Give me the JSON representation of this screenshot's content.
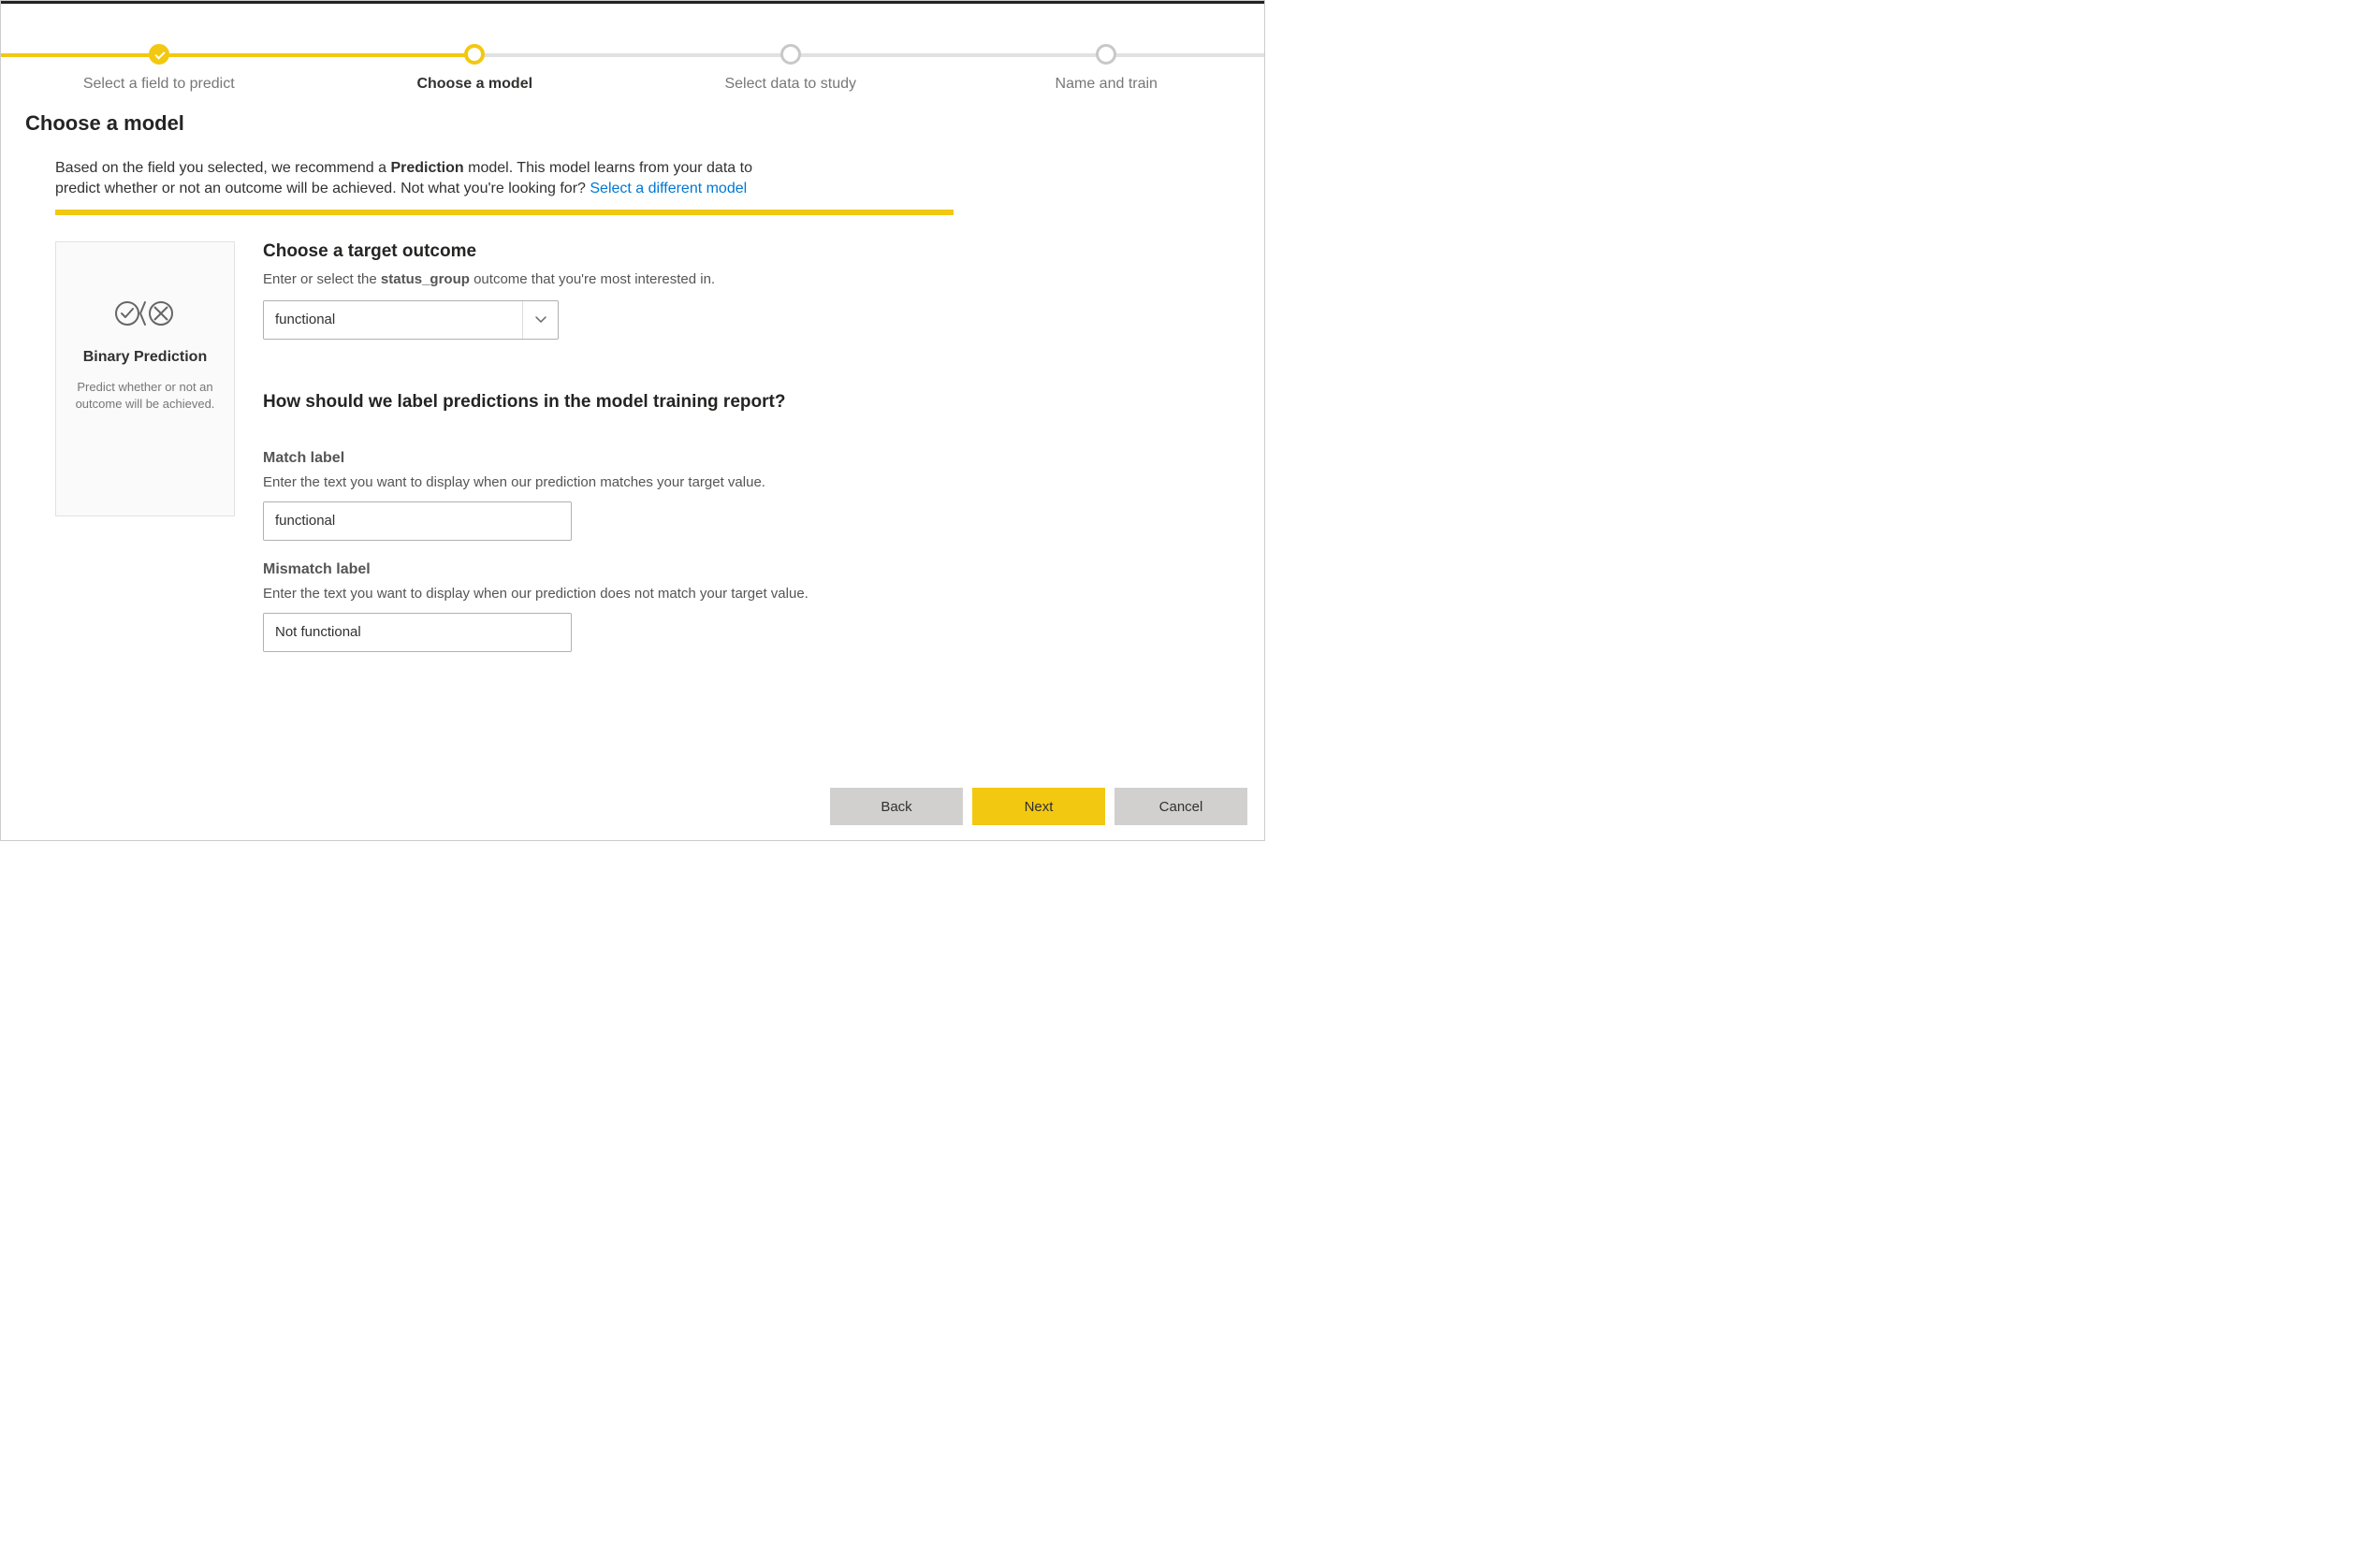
{
  "stepper": {
    "steps": [
      {
        "label": "Select a field to predict",
        "state": "completed"
      },
      {
        "label": "Choose a model",
        "state": "current"
      },
      {
        "label": "Select data to study",
        "state": "upcoming"
      },
      {
        "label": "Name and train",
        "state": "upcoming"
      }
    ]
  },
  "page": {
    "title": "Choose a model",
    "description_prefix": "Based on the field you selected, we recommend a ",
    "description_bold": "Prediction",
    "description_mid": " model. This model learns from your data to predict whether or not an outcome will be achieved. Not what you're looking for? ",
    "description_link": "Select a different model"
  },
  "model_card": {
    "title": "Binary Prediction",
    "desc": "Predict whether or not an outcome will be achieved.",
    "icon_name": "binary-prediction-icon"
  },
  "target_outcome": {
    "heading": "Choose a target outcome",
    "sub_prefix": "Enter or select the ",
    "sub_bold": "status_group",
    "sub_suffix": " outcome that you're most interested in.",
    "value": "functional"
  },
  "label_section": {
    "heading": "How should we label predictions in the model training report?",
    "match": {
      "label": "Match label",
      "sub": "Enter the text you want to display when our prediction matches your target value.",
      "value": "functional"
    },
    "mismatch": {
      "label": "Mismatch label",
      "sub": "Enter the text you want to display when our prediction does not match your target value.",
      "value": "Not functional"
    }
  },
  "footer": {
    "back": "Back",
    "next": "Next",
    "cancel": "Cancel"
  },
  "colors": {
    "accent": "#f2c811",
    "link": "#0078d4"
  }
}
